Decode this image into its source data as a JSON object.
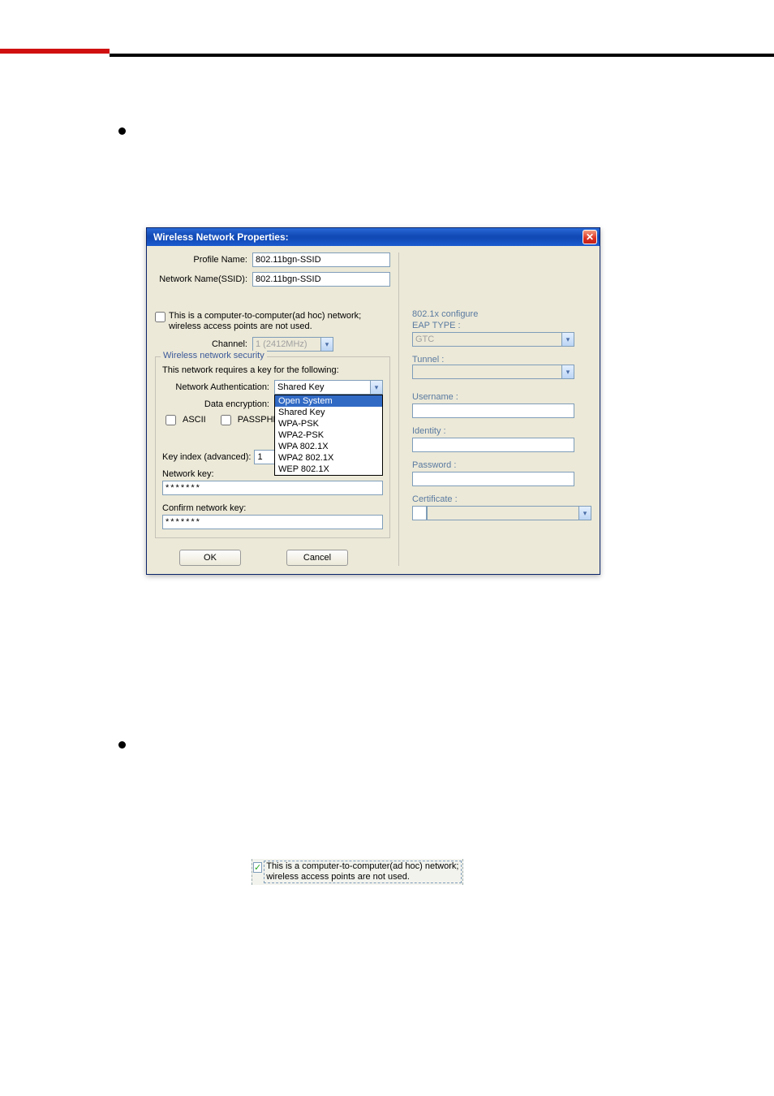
{
  "dialog": {
    "title": "Wireless Network Properties:",
    "profile_name_label": "Profile Name:",
    "profile_name_value": "802.11bgn-SSID",
    "network_name_label": "Network Name(SSID):",
    "network_name_value": "802.11bgn-SSID",
    "adhoc_text": "This is a computer-to-computer(ad hoc) network; wireless access points are not used.",
    "channel_label": "Channel:",
    "channel_value": "1 (2412MHz)",
    "security_group_title": "Wireless network security",
    "security_prompt": "This network requires a key for the following:",
    "net_auth_label": "Network Authentication:",
    "net_auth_value": "Shared Key",
    "auth_options": [
      "Open System",
      "Shared Key",
      "WPA-PSK",
      "WPA2-PSK",
      "WPA 802.1X",
      "WPA2 802.1X",
      "WEP 802.1X"
    ],
    "data_enc_label": "Data encryption:",
    "ascii_label": "ASCII",
    "passphrase_label": "PASSPHRASE",
    "key_index_label": "Key index (advanced):",
    "key_index_value": "1",
    "network_key_label": "Network key:",
    "network_key_value": "*******",
    "confirm_key_label": "Confirm network key:",
    "confirm_key_value": "*******",
    "ok_label": "OK",
    "cancel_label": "Cancel",
    "dot1x_header": "802.1x configure",
    "eap_type_label": "EAP TYPE :",
    "eap_type_value": "GTC",
    "tunnel_label": "Tunnel :",
    "username_label": "Username :",
    "identity_label": "Identity :",
    "password_label": "Password :",
    "certificate_label": "Certificate :"
  },
  "adhoc_strip": {
    "text": "This is a computer-to-computer(ad hoc) network; wireless access points are not used.",
    "checked_glyph": "✓"
  },
  "colors": {
    "accent_red": "#d01010",
    "title_gradient_top": "#2a6ad8",
    "title_gradient_bottom": "#1149b5",
    "panel_bg": "#ece9d8",
    "right_text": "#5a7aa0"
  }
}
